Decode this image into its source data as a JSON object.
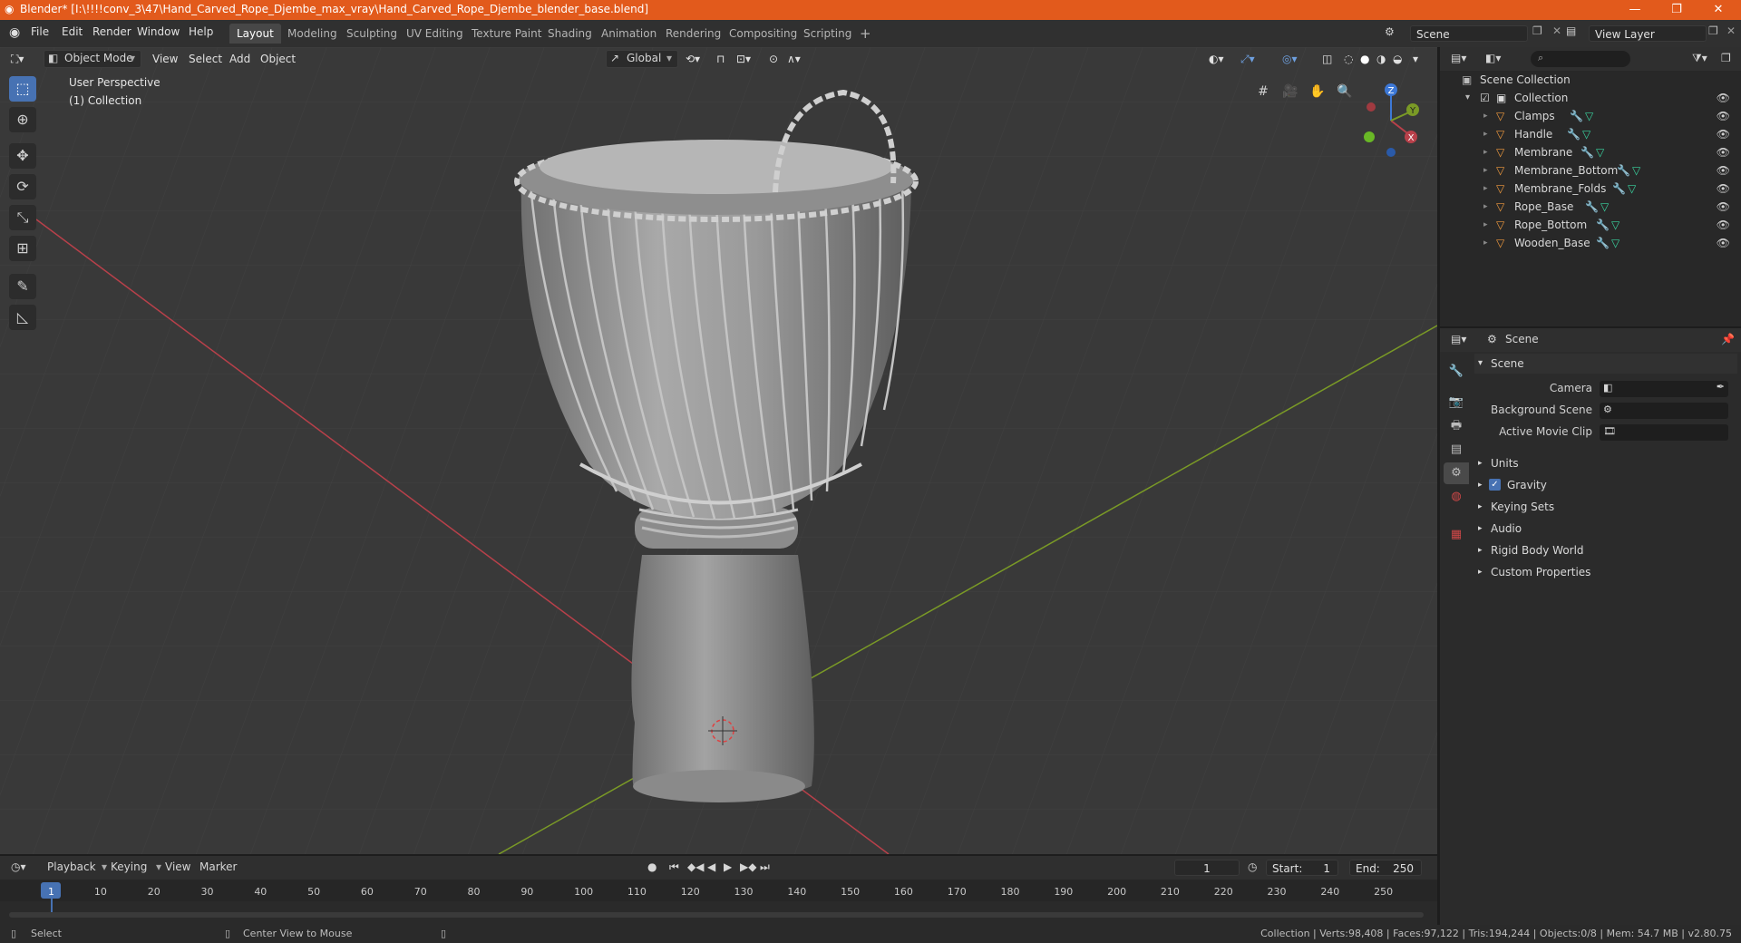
{
  "window": {
    "title": "Blender* [I:\\!!!!conv_3\\47\\Hand_Carved_Rope_Djembe_max_vray\\Hand_Carved_Rope_Djembe_blender_base.blend]",
    "minimize": "—",
    "maximize": "❐",
    "close": "✕"
  },
  "menu": {
    "items": [
      "File",
      "Edit",
      "Render",
      "Window",
      "Help"
    ],
    "workspaces": [
      "Layout",
      "Modeling",
      "Sculpting",
      "UV Editing",
      "Texture Paint",
      "Shading",
      "Animation",
      "Rendering",
      "Compositing",
      "Scripting"
    ],
    "active_workspace": "Layout",
    "add_workspace": "+",
    "scene_name": "Scene",
    "view_layer": "View Layer"
  },
  "viewport": {
    "mode": "Object Mode",
    "menus": [
      "View",
      "Select",
      "Add",
      "Object"
    ],
    "orientation": "Global",
    "overlay_title": "User Perspective",
    "overlay_collection": "(1) Collection",
    "gizmo": {
      "x": "X",
      "y": "Y",
      "z": "Z"
    }
  },
  "outliner": {
    "search_placeholder": "",
    "root": "Scene Collection",
    "collection": "Collection",
    "objects": [
      "Clamps",
      "Handle",
      "Membrane",
      "Membrane_Bottom",
      "Membrane_Folds",
      "Rope_Base",
      "Rope_Bottom",
      "Wooden_Base"
    ]
  },
  "properties": {
    "context": "Scene",
    "panel": "Scene",
    "fields": [
      {
        "label": "Camera"
      },
      {
        "label": "Background Scene"
      },
      {
        "label": "Active Movie Clip"
      }
    ],
    "sections": [
      "Units",
      "Gravity",
      "Keying Sets",
      "Audio",
      "Rigid Body World",
      "Custom Properties"
    ],
    "gravity_enabled": true
  },
  "timeline": {
    "menus": [
      "Playback",
      "Keying",
      "View",
      "Marker"
    ],
    "current_frame": "1",
    "start_label": "Start:",
    "start": "1",
    "end_label": "End:",
    "end": "250",
    "ticks": [
      "1",
      "10",
      "20",
      "30",
      "40",
      "50",
      "60",
      "70",
      "80",
      "90",
      "100",
      "110",
      "120",
      "130",
      "140",
      "150",
      "160",
      "170",
      "180",
      "190",
      "200",
      "210",
      "220",
      "230",
      "240",
      "250"
    ]
  },
  "status": {
    "left1": "Select",
    "left2": "Center View to Mouse",
    "right": "Collection | Verts:98,408 | Faces:97,122 | Tris:194,244 | Objects:0/8 | Mem: 54.7 MB | v2.80.75"
  },
  "colors": {
    "accent": "#4772b3",
    "titlebar": "#e25a1c",
    "x_axis": "#b8404a",
    "y_axis": "#7a9a26",
    "z_axis": "#3d78d6"
  }
}
